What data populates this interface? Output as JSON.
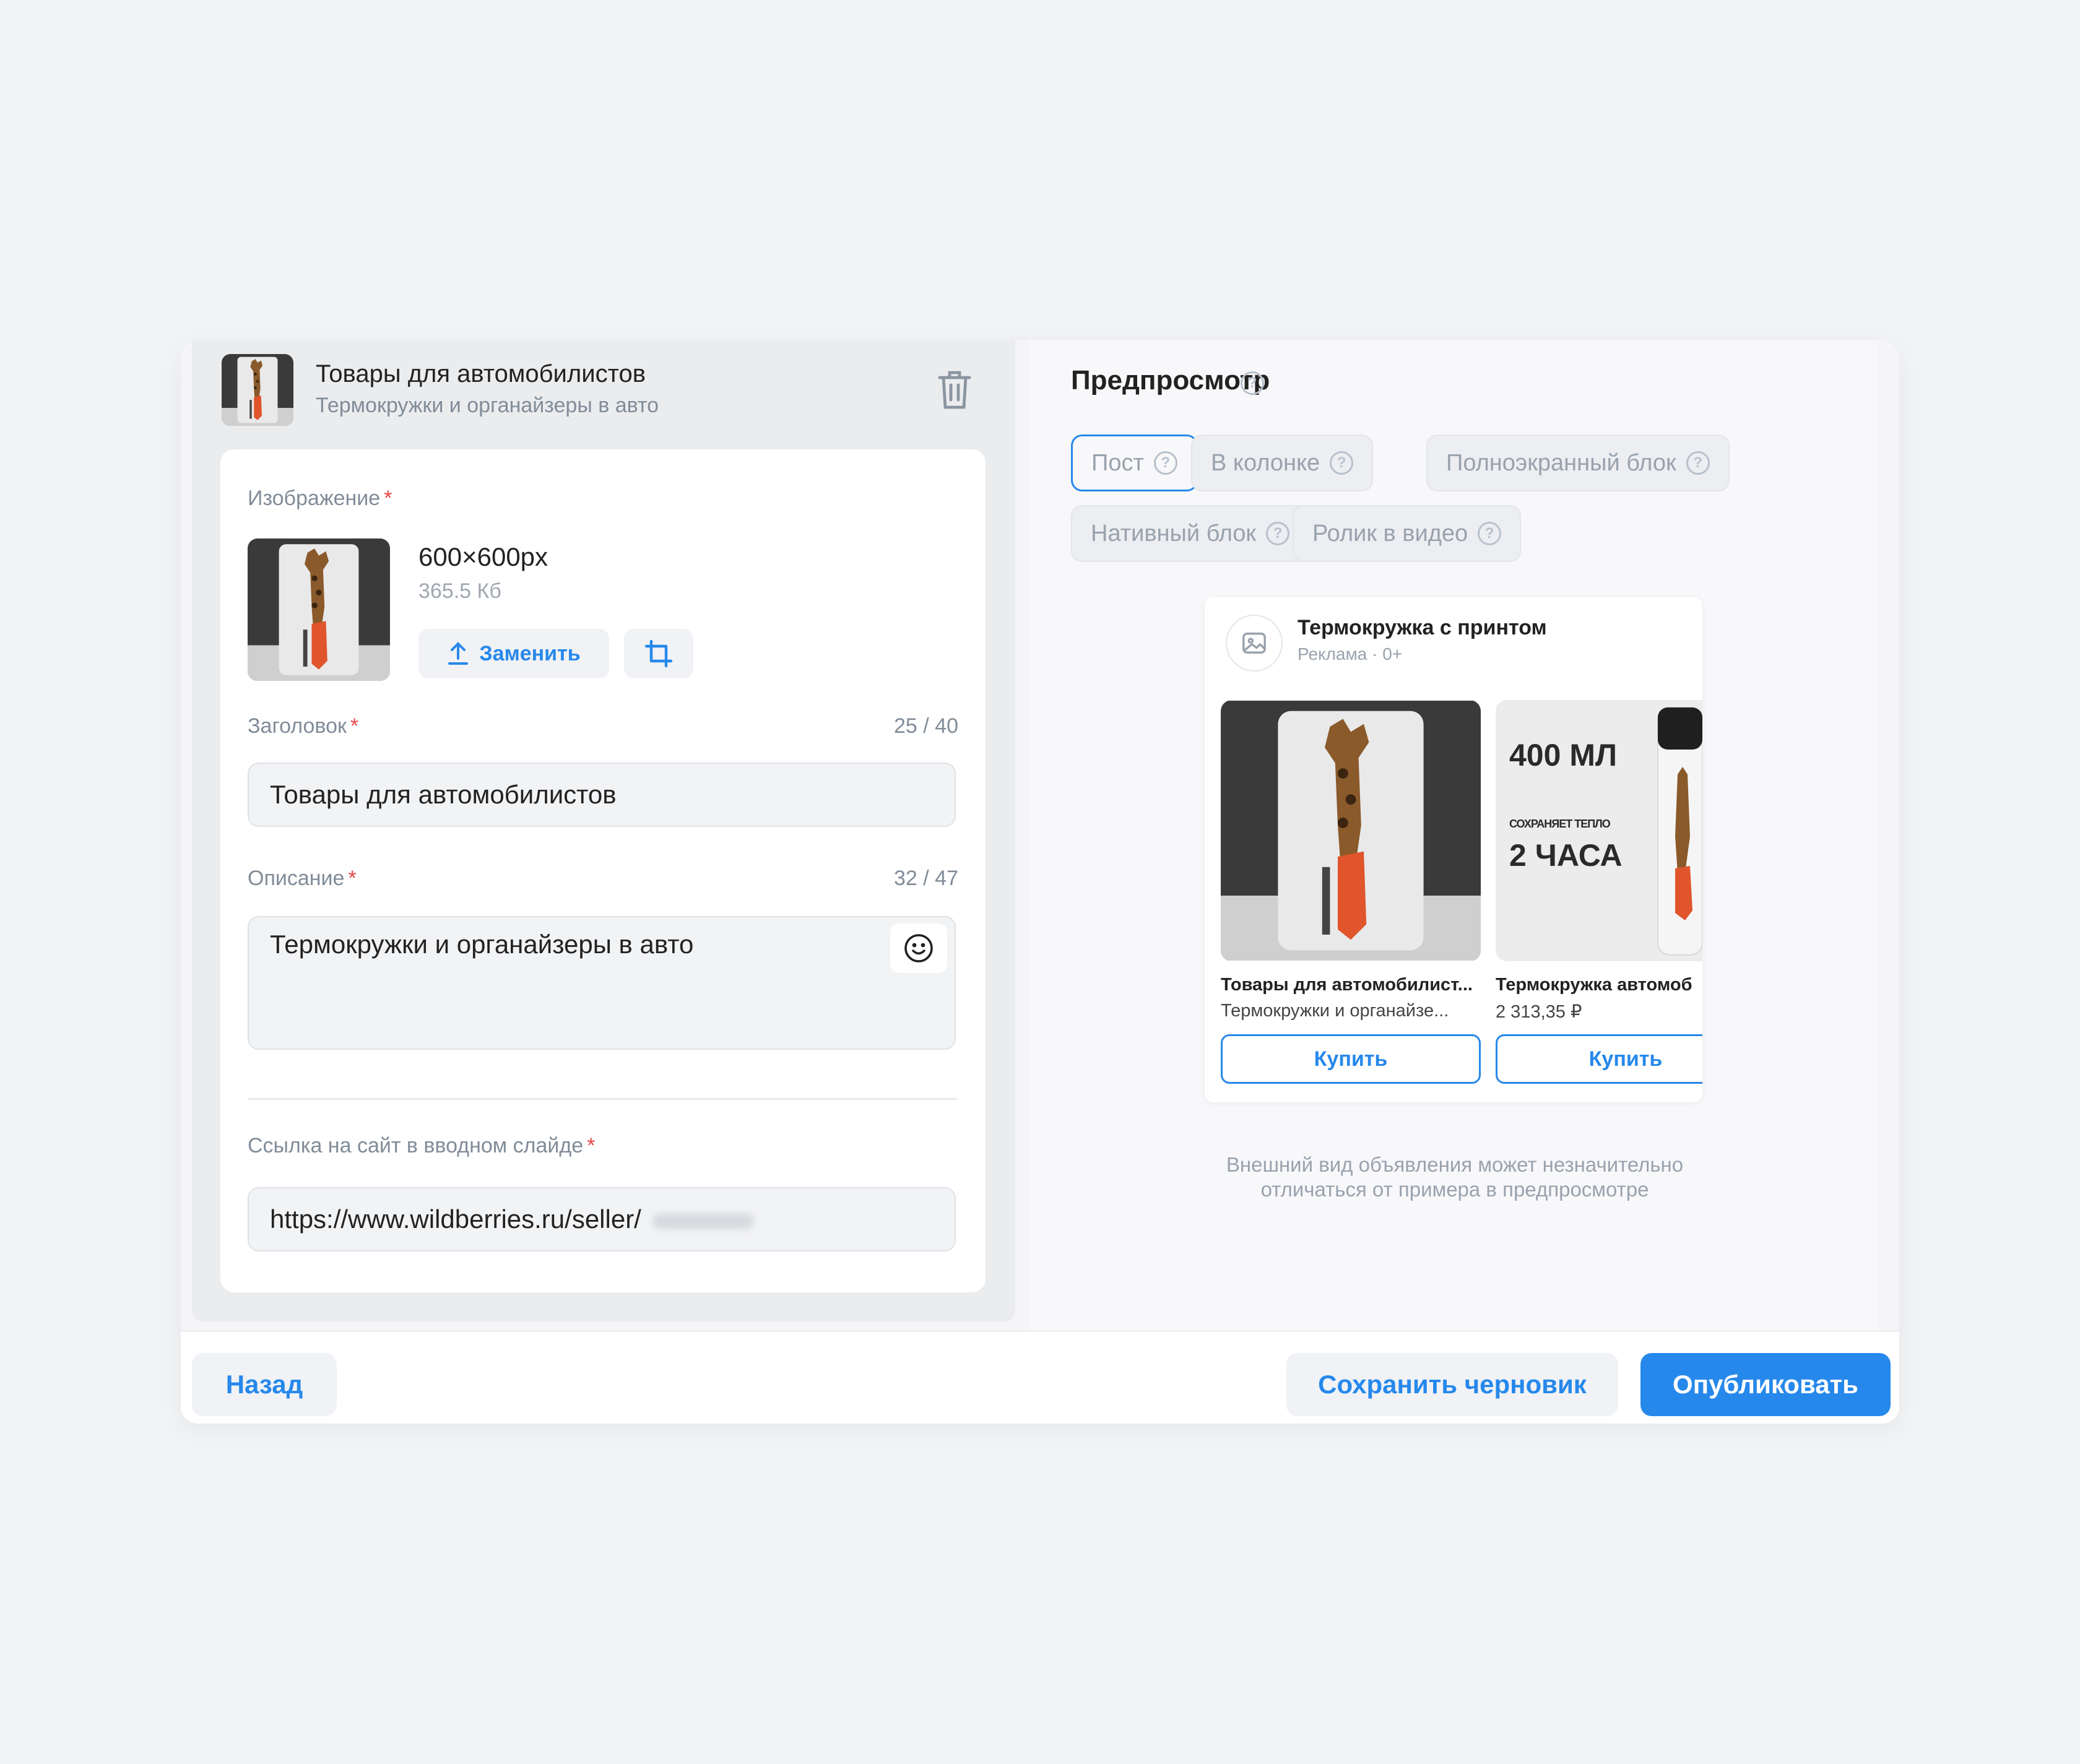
{
  "item": {
    "title": "Товары для автомобилистов",
    "subtitle": "Термокружки и органайзеры в авто"
  },
  "form": {
    "image_label": "Изображение",
    "image_dimensions": "600×600px",
    "image_size": "365.5 Кб",
    "replace_label": "Заменить",
    "heading_label": "Заголовок",
    "heading_counter": "25 / 40",
    "heading_value": "Товары для автомобилистов",
    "description_label": "Описание",
    "description_counter": "32 / 47",
    "description_value": "Термокружки и органайзеры в авто",
    "link_label": "Ссылка на сайт в вводном слайде",
    "link_value": "https://www.wildberries.ru/seller/",
    "required_mark": "*"
  },
  "preview": {
    "title": "Предпросмотр",
    "formats": [
      {
        "label": "Пост",
        "active": true
      },
      {
        "label": "В колонке",
        "active": false
      },
      {
        "label": "Полноэкранный блок",
        "active": false
      },
      {
        "label": "Нативный блок",
        "active": false
      },
      {
        "label": "Ролик в видео",
        "active": false
      }
    ],
    "help_glyph": "?",
    "card": {
      "name": "Термокружка с принтом",
      "meta": "Реклама · 0+",
      "slides": [
        {
          "title": "Товары для автомобилист...",
          "subtitle": "Термокружки и органайзе...",
          "button": "Купить"
        },
        {
          "title": "Термокружка автомоб",
          "subtitle": "2 313,35 ₽",
          "button": "Купить",
          "banner_volume": "400 МЛ",
          "banner_small": "СОХРАНЯЕТ ТЕПЛО",
          "banner_hours": "2 ЧАСА"
        }
      ]
    },
    "disclaimer_line1": "Внешний вид объявления может незначительно",
    "disclaimer_line2": "отличаться от примера в предпросмотре"
  },
  "footer": {
    "back": "Назад",
    "save_draft": "Сохранить черновик",
    "publish": "Опубликовать"
  },
  "colors": {
    "accent": "#2688eb",
    "required": "#e64646",
    "muted_text": "#818c99"
  },
  "icons": {
    "trash": "trash-icon",
    "upload": "upload-icon",
    "crop": "crop-icon",
    "emoji": "emoji-icon",
    "help": "help-icon",
    "image_placeholder": "image-icon"
  }
}
